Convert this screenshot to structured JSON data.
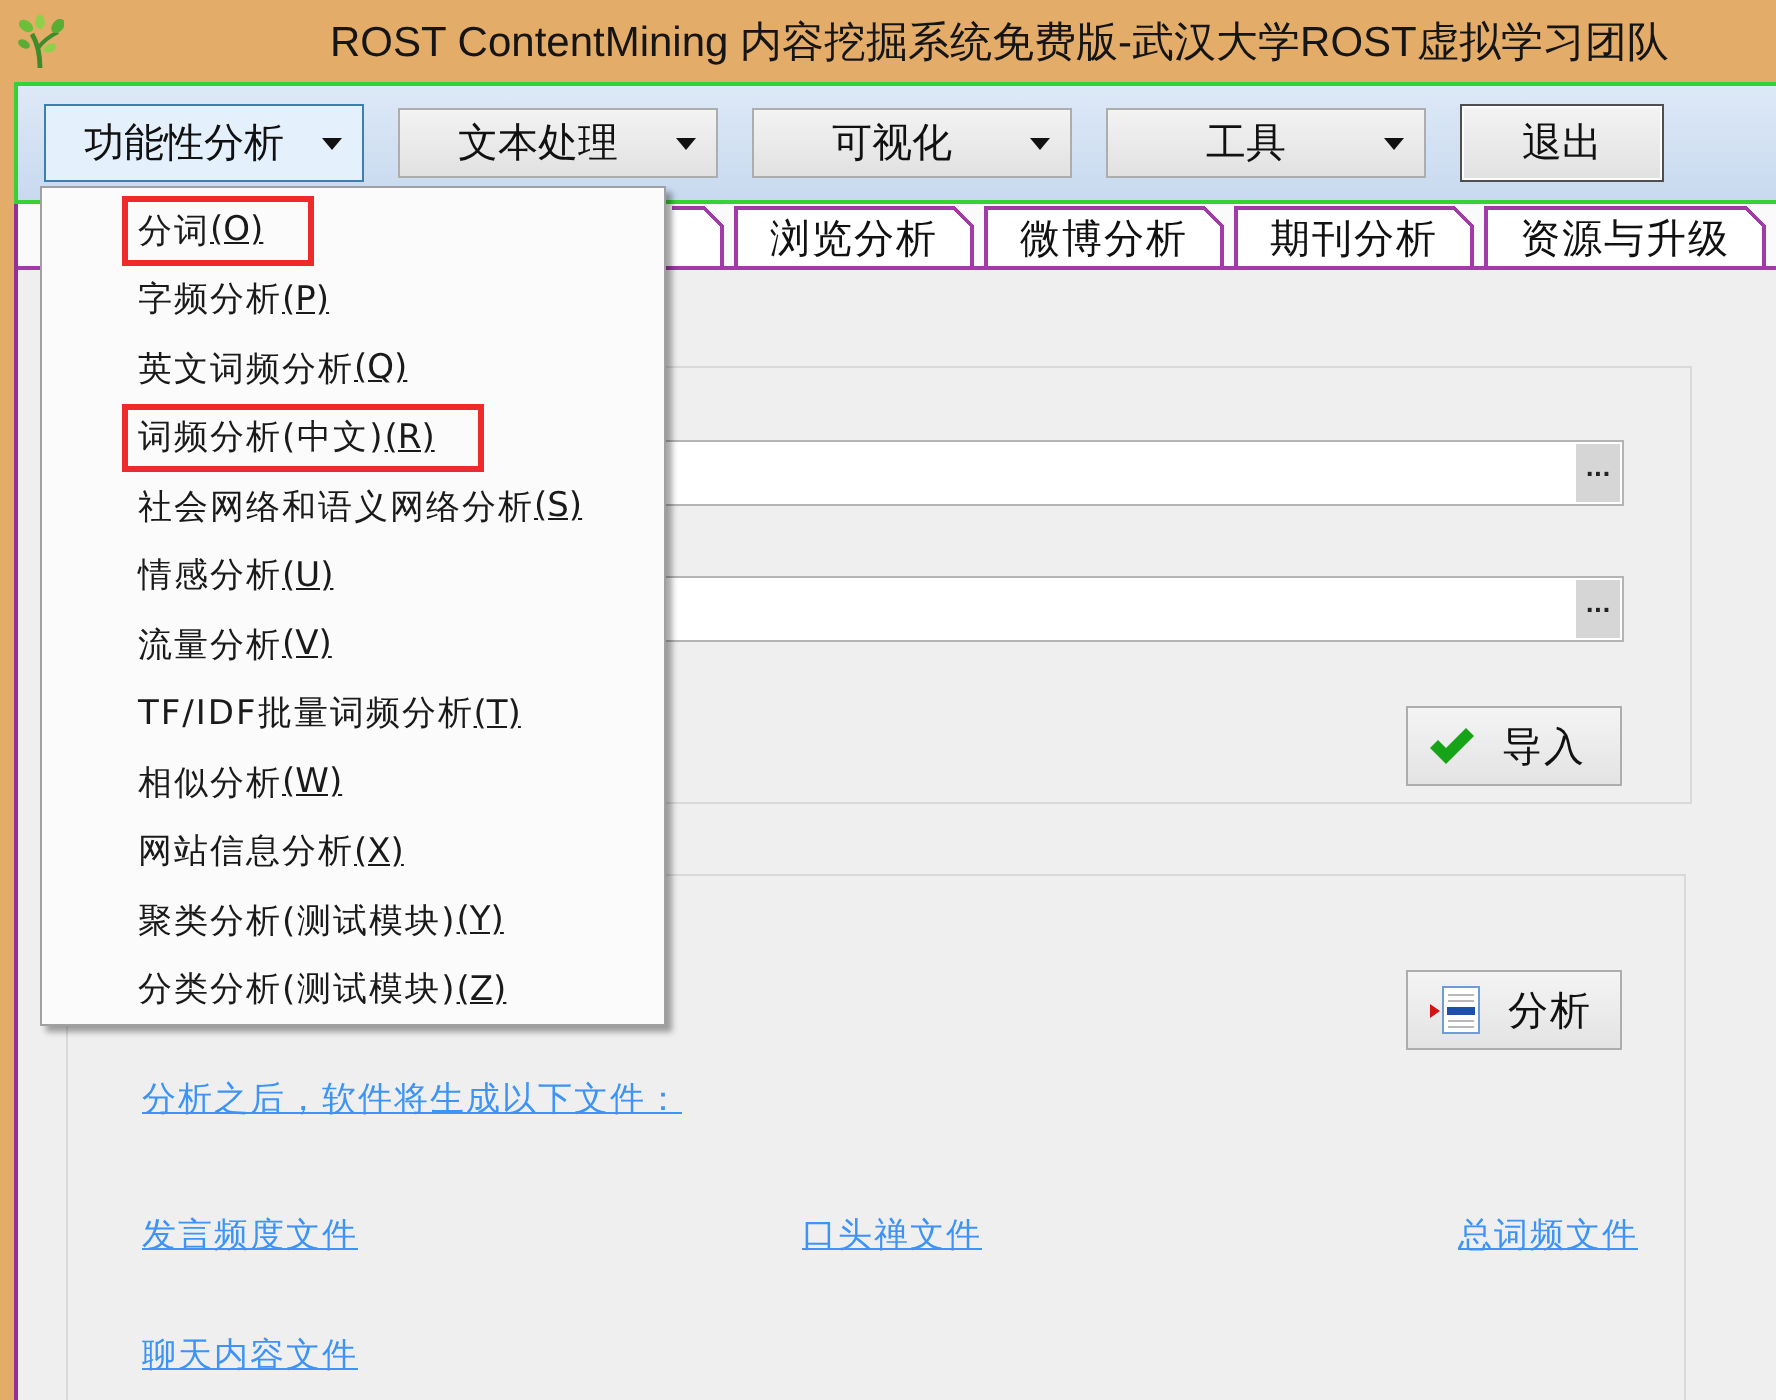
{
  "window": {
    "title": "ROST ContentMining 内容挖掘系统免费版-武汉大学ROST虚拟学习团队"
  },
  "toolbar": [
    {
      "label": "功能性分析",
      "kind": "dropdown",
      "pressed": true
    },
    {
      "label": "文本处理",
      "kind": "dropdown",
      "pressed": false
    },
    {
      "label": "可视化",
      "kind": "dropdown",
      "pressed": false
    },
    {
      "label": "工具",
      "kind": "dropdown",
      "pressed": false
    },
    {
      "label": "退出",
      "kind": "button",
      "pressed": false
    }
  ],
  "dropdown_menu": {
    "items": [
      {
        "label": "分词",
        "shortcut": "(O)",
        "highlighted": true
      },
      {
        "label": "字频分析",
        "shortcut": "(P)",
        "highlighted": false
      },
      {
        "label": "英文词频分析",
        "shortcut": "(Q)",
        "highlighted": false
      },
      {
        "label": "词频分析(中文)",
        "shortcut": "(R)",
        "highlighted": true
      },
      {
        "label": "社会网络和语义网络分析",
        "shortcut": "(S)",
        "highlighted": false
      },
      {
        "label": "情感分析",
        "shortcut": "(U)",
        "highlighted": false
      },
      {
        "label": "流量分析",
        "shortcut": "(V)",
        "highlighted": false
      },
      {
        "label": "TF/IDF批量词频分析",
        "shortcut": "(T)",
        "highlighted": false
      },
      {
        "label": "相似分析",
        "shortcut": "(W)",
        "highlighted": false
      },
      {
        "label": "网站信息分析",
        "shortcut": "(X)",
        "highlighted": false
      },
      {
        "label": "聚类分析(测试模块)",
        "shortcut": "(Y)",
        "highlighted": false
      },
      {
        "label": "分类分析(测试模块)",
        "shortcut": "(Z)",
        "highlighted": false
      }
    ]
  },
  "tabs": [
    {
      "label": "浏览分析",
      "selected": false
    },
    {
      "label": "微博分析",
      "selected": false
    },
    {
      "label": "期刊分析",
      "selected": false
    },
    {
      "label": "资源与升级",
      "selected": false
    }
  ],
  "import_panel": {
    "fields": [
      {
        "browse_label": "..."
      },
      {
        "browse_label": "..."
      }
    ],
    "button": {
      "label": "导入"
    }
  },
  "analysis_panel": {
    "button": {
      "label": "分析"
    },
    "note": "分析之后，软件将生成以下文件：",
    "files": [
      "发言频度文件",
      "口头禅文件",
      "总词频文件",
      "聊天内容文件"
    ]
  }
}
